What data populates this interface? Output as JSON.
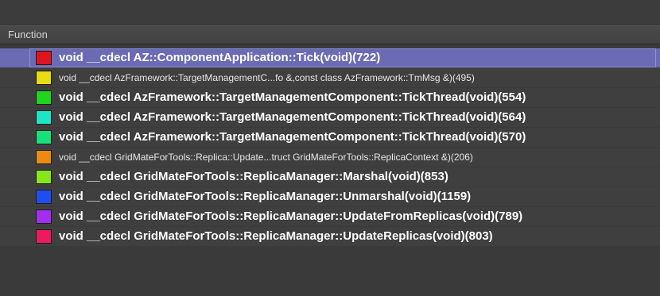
{
  "header": {
    "column_label": "Function"
  },
  "functions": [
    {
      "label": "void __cdecl AZ::ComponentApplication::Tick(void)(722)",
      "color": "#e0141e",
      "bold": true,
      "selected": true
    },
    {
      "label": "void __cdecl AzFramework::TargetManagementC...fo &,const class AzFramework::TmMsg &)(495)",
      "color": "#e8dc12",
      "bold": false,
      "selected": false
    },
    {
      "label": "void __cdecl AzFramework::TargetManagementComponent::TickThread(void)(554)",
      "color": "#22d41e",
      "bold": true,
      "selected": false
    },
    {
      "label": "void __cdecl AzFramework::TargetManagementComponent::TickThread(void)(564)",
      "color": "#1ee6c4",
      "bold": true,
      "selected": false
    },
    {
      "label": "void __cdecl AzFramework::TargetManagementComponent::TickThread(void)(570)",
      "color": "#18e07a",
      "bold": true,
      "selected": false
    },
    {
      "label": "void __cdecl GridMateForTools::Replica::Update...truct GridMateForTools::ReplicaContext &)(206)",
      "color": "#ec8a14",
      "bold": false,
      "selected": false
    },
    {
      "label": "void __cdecl GridMateForTools::ReplicaManager::Marshal(void)(853)",
      "color": "#86e61a",
      "bold": true,
      "selected": false
    },
    {
      "label": "void __cdecl GridMateForTools::ReplicaManager::Unmarshal(void)(1159)",
      "color": "#1e4ef0",
      "bold": true,
      "selected": false
    },
    {
      "label": "void __cdecl GridMateForTools::ReplicaManager::UpdateFromReplicas(void)(789)",
      "color": "#a22ef0",
      "bold": true,
      "selected": false
    },
    {
      "label": "void __cdecl GridMateForTools::ReplicaManager::UpdateReplicas(void)(803)",
      "color": "#ec1a5e",
      "bold": true,
      "selected": false
    }
  ]
}
